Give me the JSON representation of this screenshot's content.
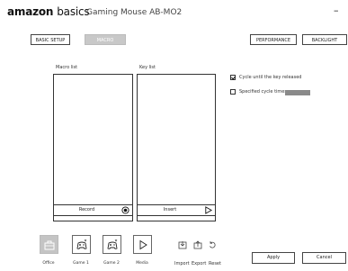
{
  "titlebar": {
    "brand_bold": "amazon",
    "brand_light": "basics",
    "product": "Gaming Mouse AB-MO2",
    "minimize_glyph": "–"
  },
  "tabs": {
    "basic_setup": "BASIC SETUP",
    "macro": "MACRO",
    "performance": "PERFORMANCE",
    "backlight": "BACKLIGHT"
  },
  "macro_list": {
    "label": "Macro list",
    "button": "Record"
  },
  "key_list": {
    "label": "Key list",
    "button": "Insert"
  },
  "options": {
    "cycle_until_release": "Cycle until the key released",
    "cycle_until_release_checked": true,
    "specified_cycle_times": "Specified cycle times",
    "specified_cycle_times_checked": false
  },
  "modes": [
    {
      "label": "Office",
      "icon": "briefcase-icon",
      "active": true
    },
    {
      "label": "Game 1",
      "icon": "gamepad-icon",
      "active": false
    },
    {
      "label": "Game 2",
      "icon": "gamepad-icon",
      "active": false
    },
    {
      "label": "Media",
      "icon": "play-icon",
      "active": false
    }
  ],
  "file_actions": {
    "import": "Import",
    "export": "Export",
    "reset": "Reset"
  },
  "footer": {
    "apply": "Apply",
    "cancel": "Cancel"
  },
  "colors": {
    "active_tab": "#c8c8c8",
    "active_mode": "#c4c4c4",
    "cycle_field": "#8a8a8a"
  }
}
